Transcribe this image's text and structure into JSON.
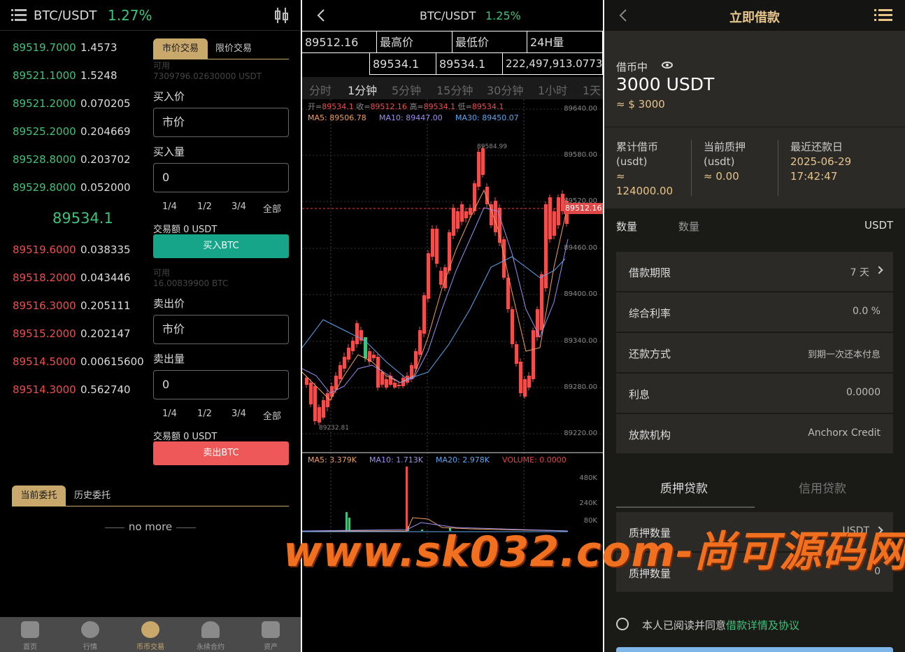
{
  "spot": {
    "pair": "BTC/USDT",
    "change": "1.27%",
    "asks": [
      {
        "price": "89519.7000",
        "amount": "1.4573"
      },
      {
        "price": "89521.1000",
        "amount": "1.5248"
      },
      {
        "price": "89521.2000",
        "amount": "0.070205"
      },
      {
        "price": "89525.2000",
        "amount": "0.204669"
      },
      {
        "price": "89528.8000",
        "amount": "0.203702"
      },
      {
        "price": "89529.8000",
        "amount": "0.052000"
      }
    ],
    "last_price": "89534.1",
    "bids": [
      {
        "price": "89519.6000",
        "amount": "0.038335"
      },
      {
        "price": "89518.2000",
        "amount": "0.043446"
      },
      {
        "price": "89516.3000",
        "amount": "0.205111"
      },
      {
        "price": "89515.2000",
        "amount": "0.202147"
      },
      {
        "price": "89514.5000",
        "amount": "0.00615600"
      },
      {
        "price": "89514.3000",
        "amount": "0.562740"
      }
    ],
    "tab_market": "市价交易",
    "tab_limit": "限价交易",
    "avail_label": "可用",
    "avail_usdt": "7309796.02630000 USDT",
    "buy_price_label": "买入价",
    "buy_price_value": "市价",
    "buy_amount_label": "买入量",
    "buy_amount_value": "0",
    "fractions": [
      "1/4",
      "1/2",
      "3/4",
      "全部"
    ],
    "buy_total": "交易额 0 USDT",
    "buy_button": "买入BTC",
    "avail_btc": "16.00839900 BTC",
    "sell_price_label": "卖出价",
    "sell_price_value": "市价",
    "sell_amount_label": "卖出量",
    "sell_amount_value": "0",
    "sell_total": "交易额 0 USDT",
    "sell_button": "卖出BTC",
    "orders_tab_current": "当前委托",
    "orders_tab_history": "历史委托",
    "no_more": "no more",
    "nav": [
      "首页",
      "行情",
      "币币交易",
      "永续合约",
      "资产"
    ]
  },
  "kline": {
    "pair": "BTC/USDT",
    "change": "1.25%",
    "stat_labels": [
      "89512.16",
      "最高价",
      "最低价",
      "24H量"
    ],
    "stat_values": [
      "89534.1",
      "89534.1",
      "222,497,913.0773"
    ],
    "periods": [
      "分时",
      "1分钟",
      "5分钟",
      "15分钟",
      "30分钟",
      "1小时",
      "1天"
    ],
    "ohlc": {
      "open": "89534.1",
      "close": "89512.16",
      "high": "89534.1",
      "low": "89534.1"
    },
    "ohlc_labels": {
      "open": "开=",
      "close": "收=",
      "high": "高=",
      "low": "低="
    },
    "ma": [
      "MA5: 89506.78",
      "MA10: 89447.00",
      "MA30: 89450.07"
    ],
    "price_axis": [
      "89640.00",
      "89580.00",
      "89520.00",
      "89460.00",
      "89400.00",
      "89340.00",
      "89280.00",
      "89220.00"
    ],
    "current_price": "89512.16",
    "high_note": "89584.99",
    "low_note": "89232.81",
    "vol_legend": [
      "MA5: 3.379K",
      "MA10: 1.713K",
      "MA20: 2.978K",
      "VOLUME: 0.0000"
    ],
    "vol_axis": [
      "480K",
      "240K",
      "80K"
    ],
    "colors": {
      "up": "#3ec47a",
      "down": "#f04d4d",
      "ma5": "#f0a060",
      "ma10": "#9a90f0",
      "ma30": "#5aa8f0"
    }
  },
  "loan": {
    "title": "立即借款",
    "status": "借币中",
    "amount": "3000 USDT",
    "approx": "≈ $ 3000",
    "stats": [
      {
        "label1": "累计借币",
        "label2": "(usdt)",
        "value1": "≈",
        "value2": "124000.00"
      },
      {
        "label1": "当前质押",
        "label2": "(usdt)",
        "value1": "≈ 0.00",
        "value2": ""
      },
      {
        "label1": "最近还款日",
        "label2": "2025-06-29",
        "value1": "17:42:47",
        "value2": ""
      }
    ],
    "qty_label": "数量",
    "qty_placeholder": "数量",
    "qty_unit": "USDT",
    "rows": [
      {
        "k": "借款期限",
        "v": "7 天"
      },
      {
        "k": "综合利率",
        "v": "0.0 %"
      },
      {
        "k": "还款方式",
        "v": "到期一次还本付息"
      },
      {
        "k": "利息",
        "v": "0.0000"
      },
      {
        "k": "放款机构",
        "v": "Anchorx Credit"
      }
    ],
    "tab_pledge": "质押贷款",
    "tab_credit": "信用贷款",
    "pledge_rows": [
      {
        "k": "质押数量",
        "v": "USDT"
      },
      {
        "k": "质押数量",
        "v": "0"
      }
    ],
    "agree_text": "本人已阅读并同意",
    "agree_link": "借款详情及协议"
  },
  "watermark": "www.sk032.com-尚可源码网"
}
